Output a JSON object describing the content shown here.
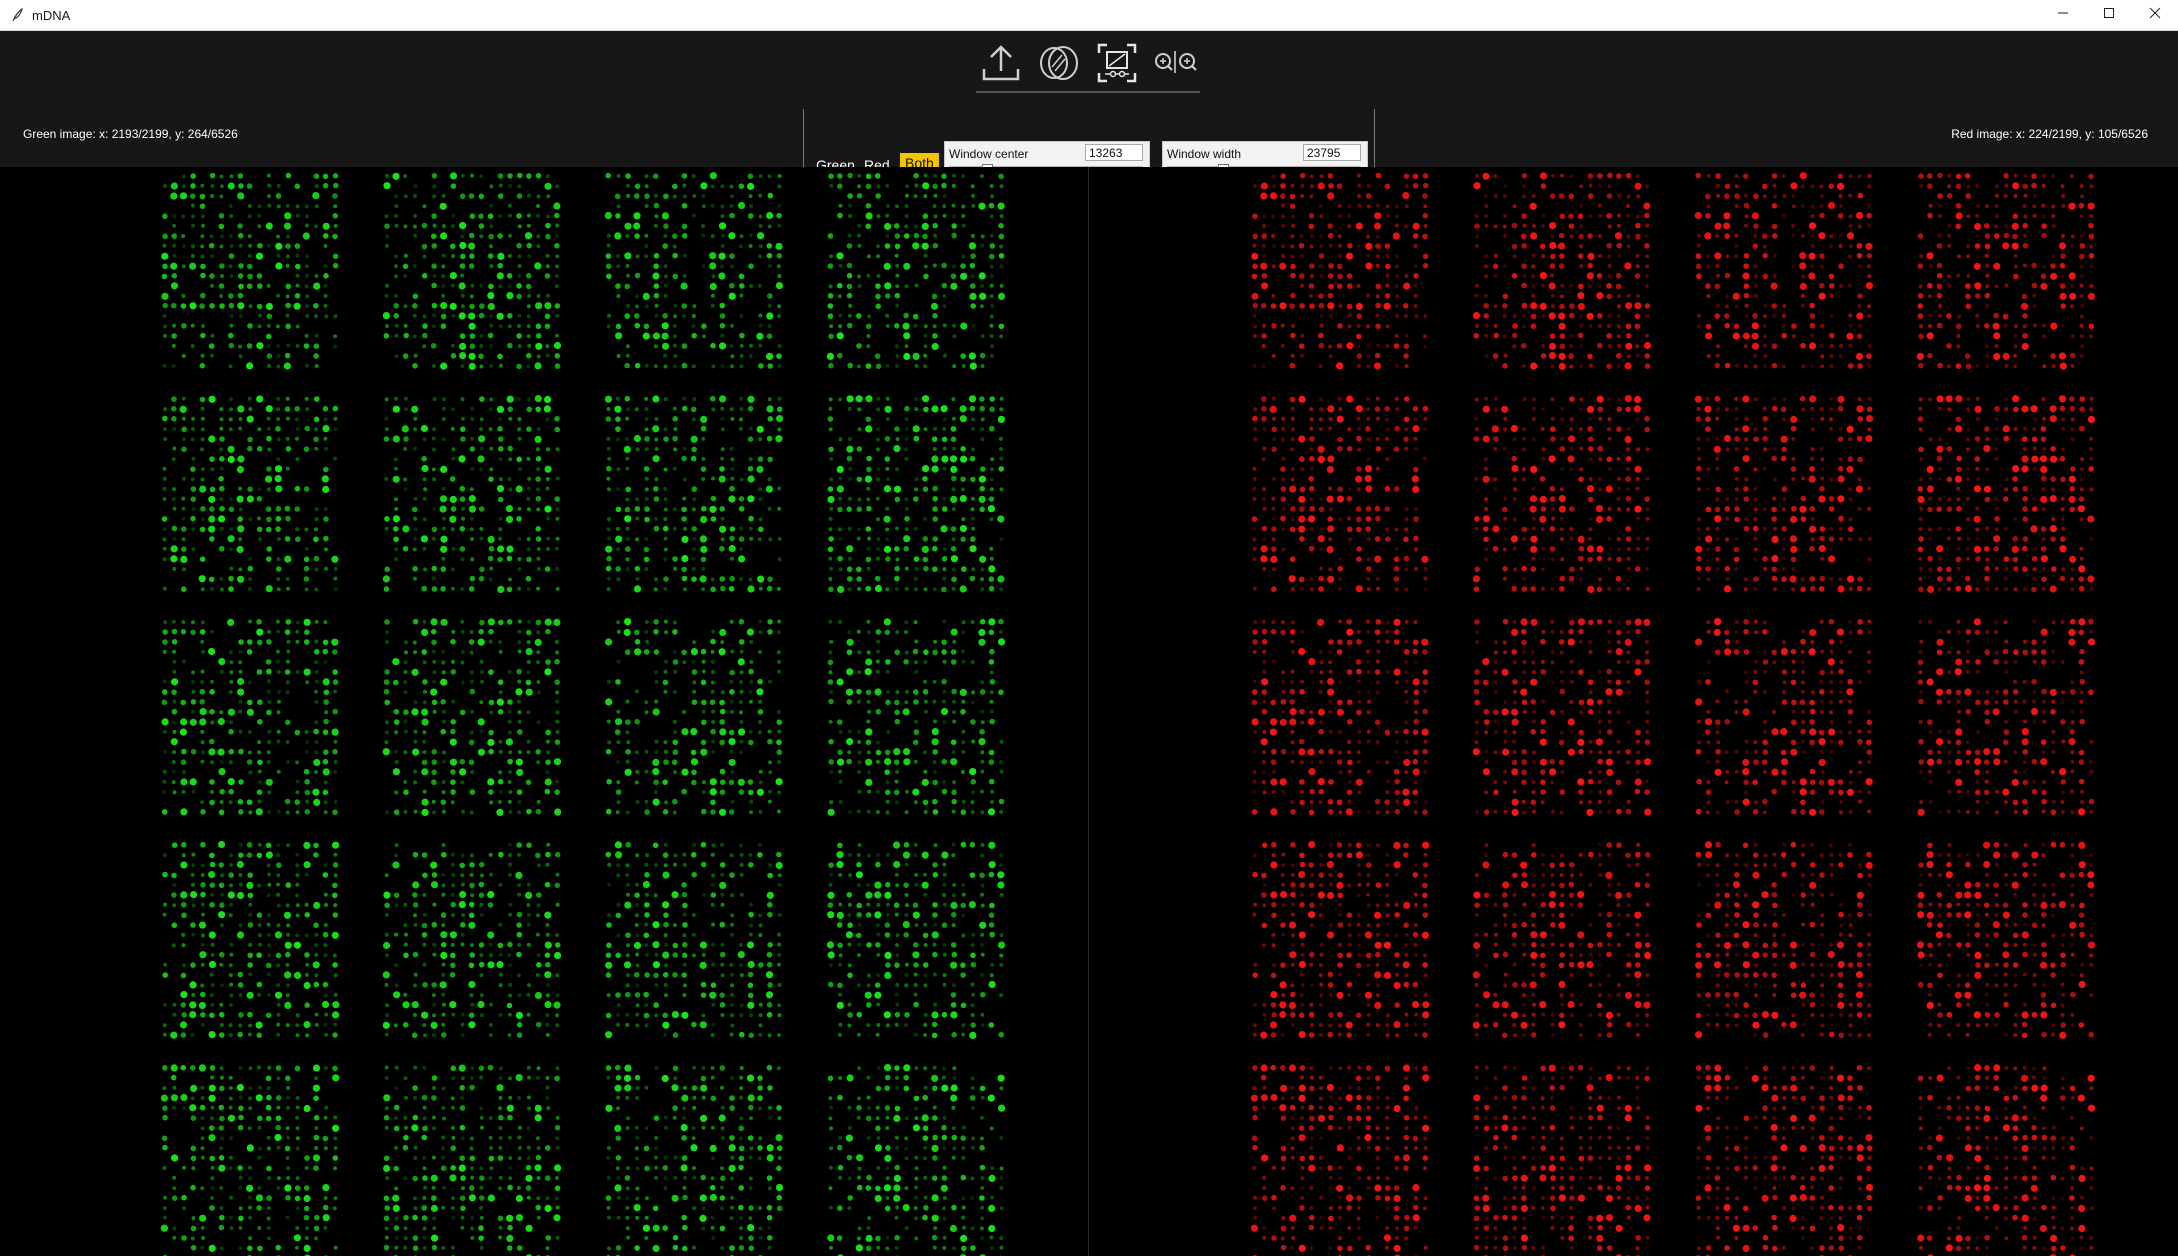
{
  "window": {
    "title": "mDNA",
    "icons": [
      "feather-icon",
      "minimize-icon",
      "maximize-icon",
      "close-icon"
    ]
  },
  "toolbar": {
    "tools": [
      {
        "name": "upload-icon"
      },
      {
        "name": "overlay-icon"
      },
      {
        "name": "fit-image-icon"
      },
      {
        "name": "zoom-icon"
      }
    ]
  },
  "info": {
    "green": "Green image: x: 2193/2199, y: 264/6526",
    "red": "Red image: x: 224/2199, y: 105/6526"
  },
  "channels": {
    "green_label": "Green",
    "red_label": "Red",
    "both_label": "Both",
    "selected": "Both",
    "selected_color": "#f5c400"
  },
  "window_center": {
    "label": "Window center",
    "value": "13263",
    "position": 0.18
  },
  "window_width": {
    "label": "Window width",
    "value": "23795",
    "position": 0.28
  },
  "images": {
    "green_color": "#19e619",
    "red_color": "#ff1414",
    "block_columns": 4,
    "block_rows": 5
  }
}
